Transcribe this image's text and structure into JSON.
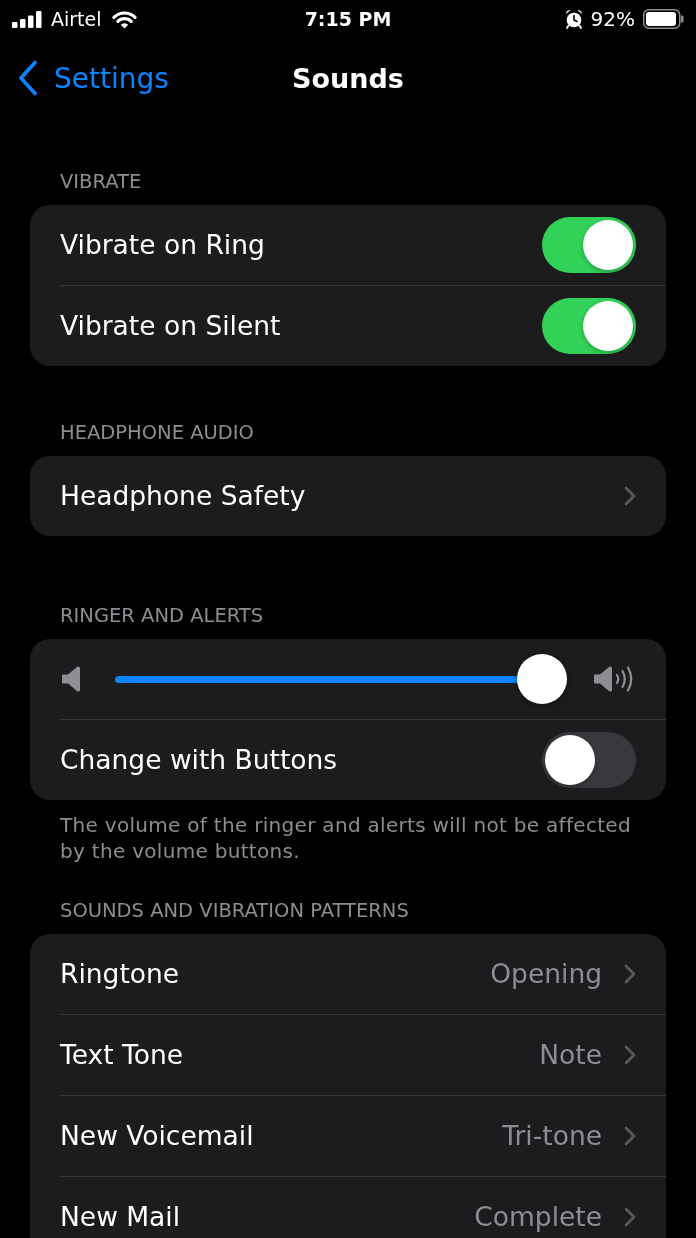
{
  "status_bar": {
    "carrier": "Airtel",
    "time": "7:15 PM",
    "battery": "92%"
  },
  "nav": {
    "back": "Settings",
    "title": "Sounds"
  },
  "sections": [
    {
      "header": "VIBRATE",
      "rows": [
        {
          "kind": "toggle",
          "label": "Vibrate on Ring",
          "on": true
        },
        {
          "kind": "toggle",
          "label": "Vibrate on Silent",
          "on": true
        }
      ]
    },
    {
      "header": "HEADPHONE AUDIO",
      "rows": [
        {
          "kind": "link",
          "label": "Headphone Safety"
        }
      ]
    },
    {
      "header": "RINGER AND ALERTS",
      "rows": [
        {
          "kind": "slider",
          "level": 1
        },
        {
          "kind": "toggle",
          "label": "Change with Buttons",
          "on": false
        }
      ],
      "footer": "The volume of the ringer and alerts will not be affected by the volume buttons."
    },
    {
      "header": "SOUNDS AND VIBRATION PATTERNS",
      "rows": [
        {
          "kind": "link",
          "label": "Ringtone",
          "value": "Opening"
        },
        {
          "kind": "link",
          "label": "Text Tone",
          "value": "Note"
        },
        {
          "kind": "link",
          "label": "New Voicemail",
          "value": "Tri-tone"
        },
        {
          "kind": "link",
          "label": "New Mail",
          "value": "Complete"
        }
      ]
    }
  ]
}
